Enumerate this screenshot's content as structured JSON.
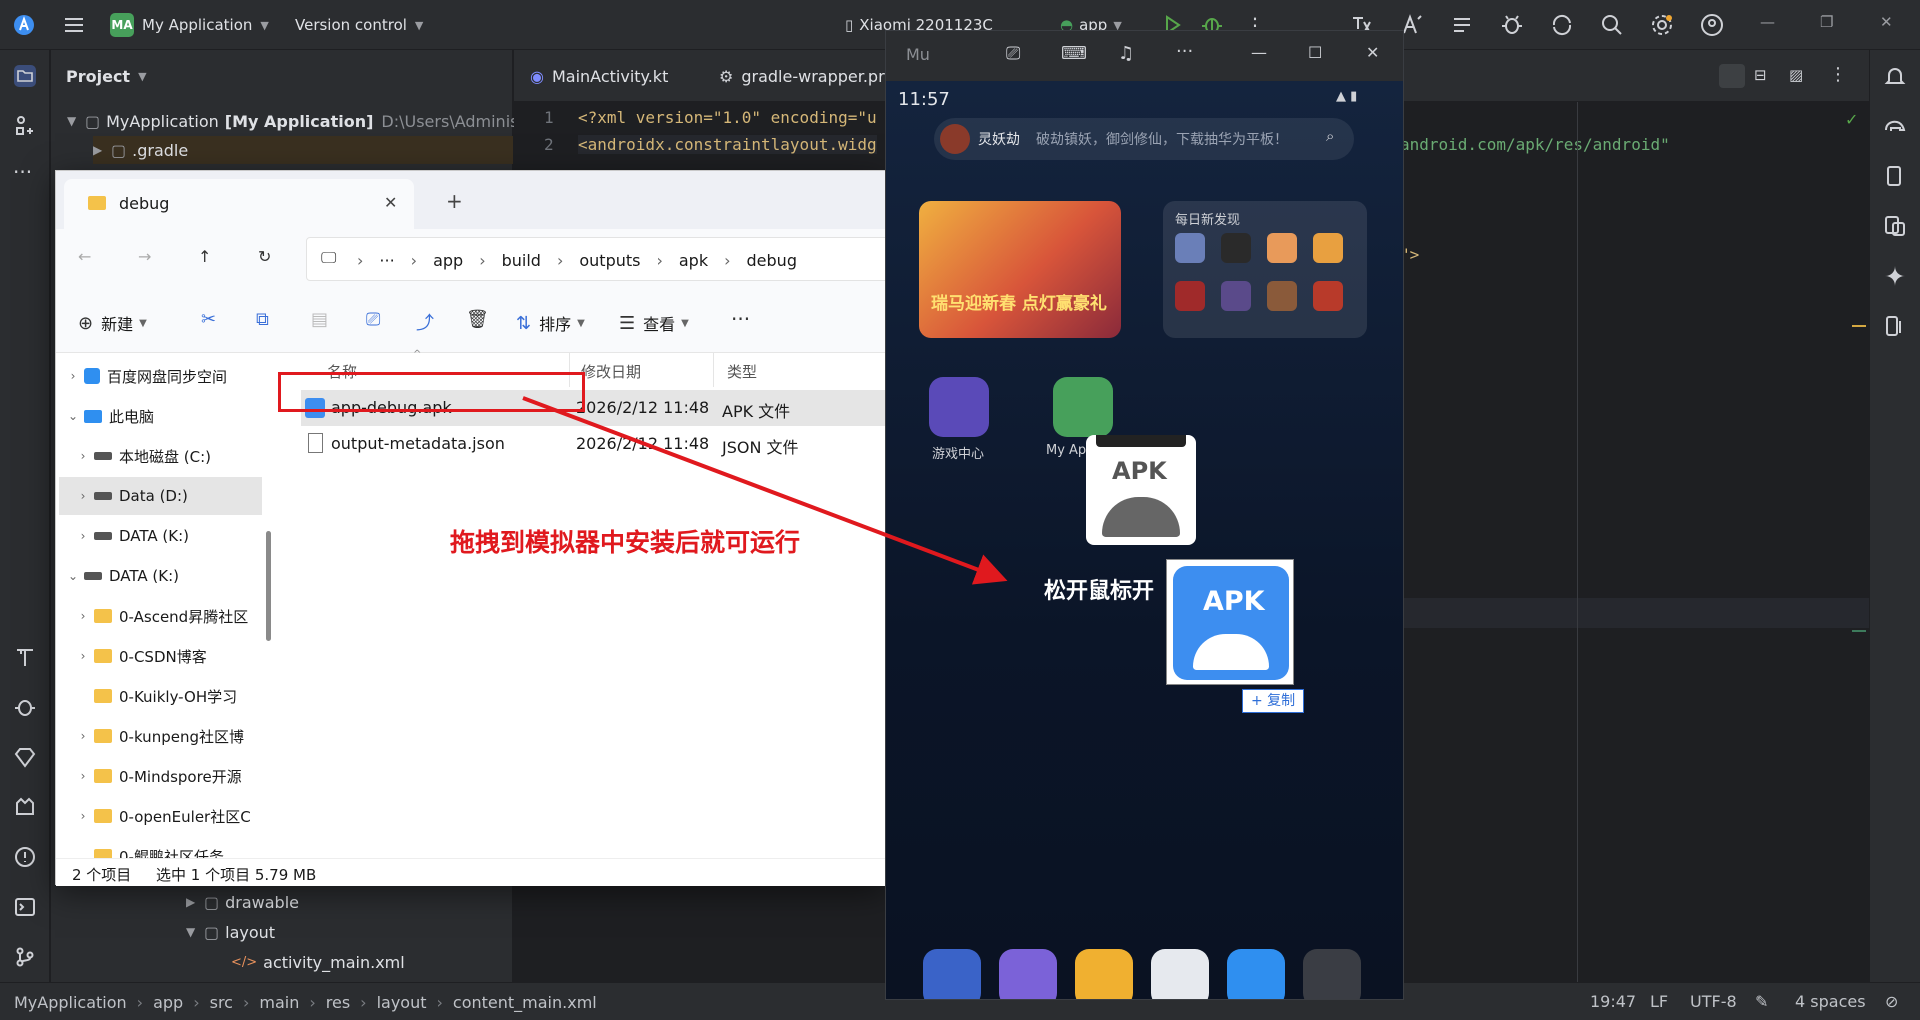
{
  "ide": {
    "project_name": "My Application",
    "project_badge": "MA",
    "vcs": "Version control",
    "device": "Xiaomi 2201123C",
    "run_config": "app",
    "panel_title": "Project",
    "tabs": [
      {
        "label": "MainActivity.kt"
      },
      {
        "label": "gradle-wrapper.pro"
      }
    ],
    "tree": {
      "root_name": "MyApplication",
      "root_bold": "[My Application]",
      "root_path": "D:\\Users\\Administrat",
      "gradle": ".gradle",
      "drawable": "drawable",
      "layout": "layout",
      "activity_main": "activity_main.xml"
    },
    "code": {
      "line1_num": "1",
      "line2_num": "2",
      "line1": "<?xml version=\"1.0\" encoding=\"u",
      "line2": "<androidx.constraintlayout.widg",
      "line2_right": "android.com/apk/res/android\"",
      "line_tail": "\">"
    },
    "status": {
      "crumbs": [
        "MyApplication",
        "app",
        "src",
        "main",
        "res",
        "layout",
        "content_main.xml"
      ],
      "position": "19:47",
      "line_sep": "LF",
      "encoding": "UTF-8",
      "indent": "4 spaces"
    }
  },
  "explorer": {
    "tab_title": "debug",
    "path": [
      "app",
      "build",
      "outputs",
      "apk",
      "debug"
    ],
    "path_more": "···",
    "new_label": "新建",
    "sort_label": "排序",
    "view_label": "查看",
    "more": "···",
    "nav": [
      {
        "label": "百度网盘同步空间"
      },
      {
        "label": "此电脑"
      },
      {
        "label": "本地磁盘 (C:)"
      },
      {
        "label": "Data (D:)"
      },
      {
        "label": "DATA (K:)"
      },
      {
        "label": "DATA (K:)"
      },
      {
        "label": "0-Ascend昇腾社区"
      },
      {
        "label": "0-CSDN博客"
      },
      {
        "label": "0-Kuikly-OH学习"
      },
      {
        "label": "0-kunpeng社区博"
      },
      {
        "label": "0-Mindspore开源"
      },
      {
        "label": "0-openEuler社区C"
      },
      {
        "label": "0-鲲鹏社区任务"
      }
    ],
    "columns": {
      "name": "名称",
      "modified": "修改日期",
      "type": "类型"
    },
    "files": [
      {
        "name": "app-debug.apk",
        "modified": "2026/2/12 11:48",
        "type": "APK 文件"
      },
      {
        "name": "output-metadata.json",
        "modified": "2026/2/12 11:48",
        "type": "JSON 文件"
      }
    ],
    "status_count": "2 个项目",
    "status_selected": "选中 1 个项目  5.79 MB"
  },
  "emulator": {
    "title": "Mu",
    "time": "11:57",
    "search_user": "灵妖劫",
    "search_text": "破劫镇妖，御剑修仙，下载抽华为平板！",
    "banner_text": "瑞马迎新春 点灯赢豪礼",
    "daily_title": "每日新发现",
    "apps": [
      {
        "label": "游戏中心"
      },
      {
        "label": "My Applic"
      }
    ],
    "apk_text": "APK",
    "drop_text": "松开鼠标开",
    "copy_label": "+ 复制"
  },
  "annotation": "拖拽到模拟器中安装后就可运行",
  "colors": {
    "ide_bg": "#2b2d30",
    "editor_bg": "#1e1f22",
    "accent_red": "#e0191e",
    "apk_blue": "#3d8ef0",
    "android_green": "#47a05b"
  }
}
